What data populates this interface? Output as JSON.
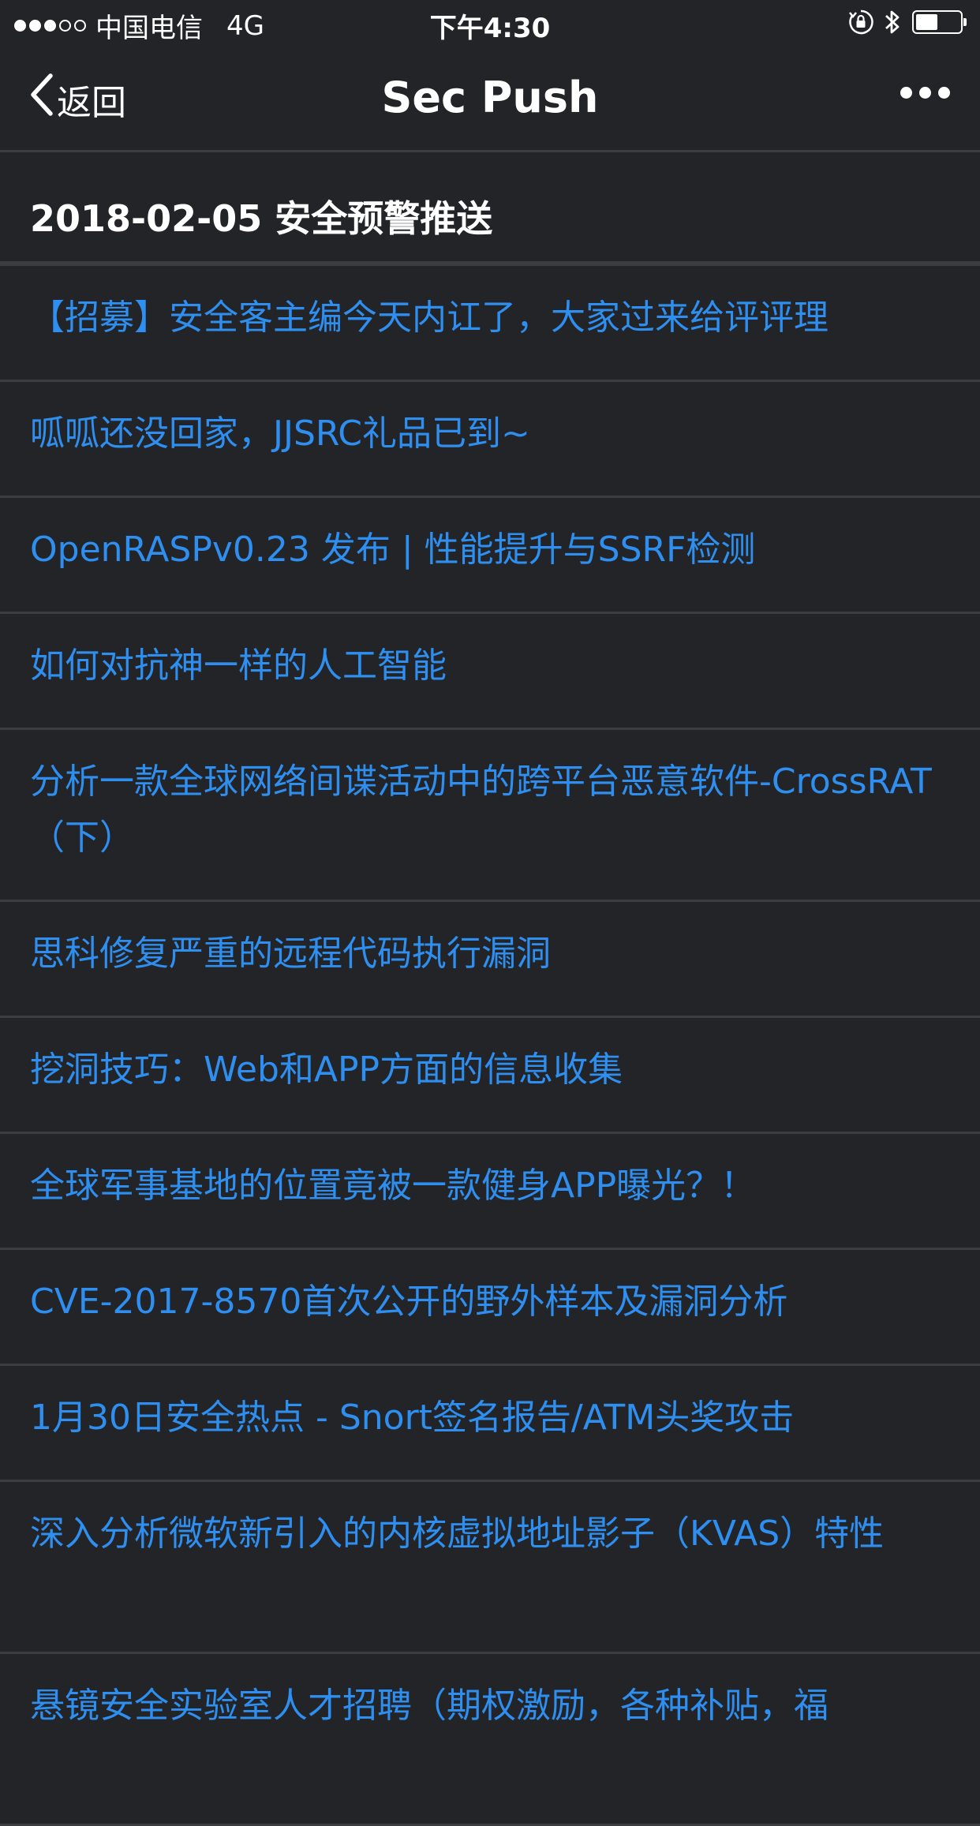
{
  "status_bar": {
    "carrier": "中国电信",
    "network": "4G",
    "time": "下午4:30",
    "battery_level": 0.5
  },
  "nav": {
    "back_label": "返回",
    "title": "Sec Push"
  },
  "header": {
    "title": "2018-02-05 安全预警推送"
  },
  "articles": [
    {
      "title": "【招募】安全客主编今天内讧了，大家过来给评评理"
    },
    {
      "title": "呱呱还没回家，JJSRC礼品已到~"
    },
    {
      "title": "OpenRASPv0.23 发布 | 性能提升与SSRF检测"
    },
    {
      "title": "如何对抗神一样的人工智能"
    },
    {
      "title": "分析一款全球网络间谍活动中的跨平台恶意软件-CrossRAT（下）"
    },
    {
      "title": "思科修复严重的远程代码执行漏洞"
    },
    {
      "title": "挖洞技巧：Web和APP方面的信息收集"
    },
    {
      "title": "全球军事基地的位置竟被一款健身APP曝光？！"
    },
    {
      "title": "CVE-2017-8570首次公开的野外样本及漏洞分析"
    },
    {
      "title": "1月30日安全热点 - Snort签名报告/ATM头奖攻击"
    },
    {
      "title": "深入分析微软新引入的内核虚拟地址影子（KVAS）特性"
    },
    {
      "title": "悬镜安全实验室人才招聘（期权激励，各种补贴，福"
    }
  ],
  "colors": {
    "background": "#232427",
    "divider": "#3c3d41",
    "link": "#2e8ff0",
    "text": "#ffffff"
  }
}
